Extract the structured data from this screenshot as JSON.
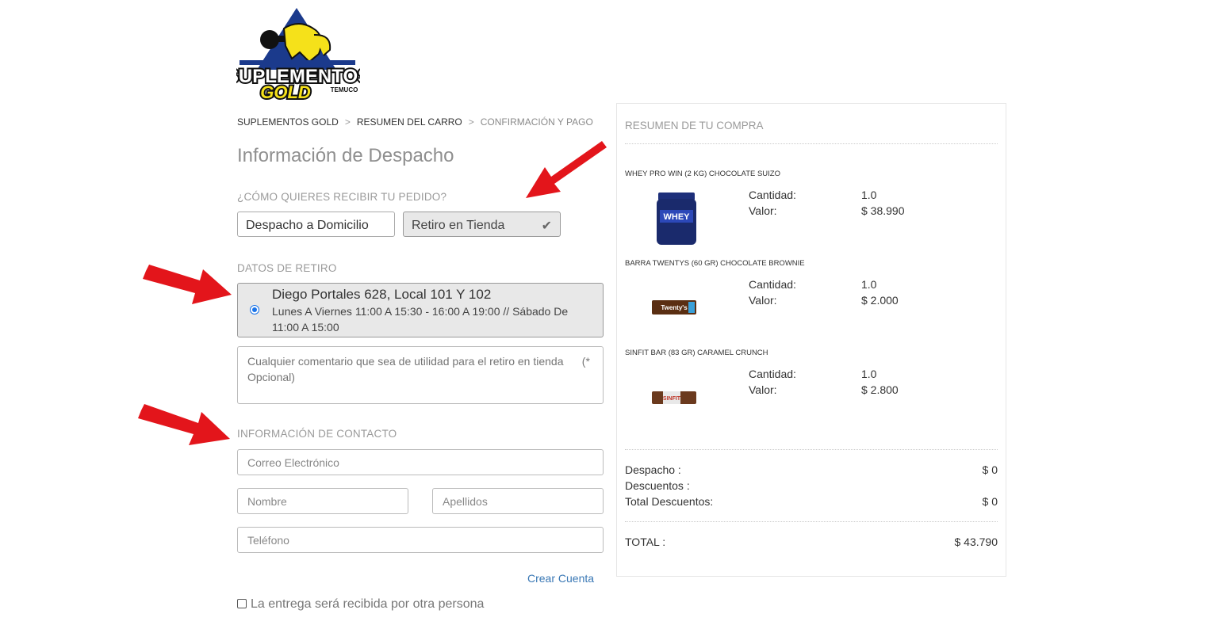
{
  "brand": {
    "logo_line1": "SUPLEMENTOS",
    "logo_line2": "GOLD",
    "logo_city": "TEMUCO"
  },
  "breadcrumb": [
    "SUPLEMENTOS GOLD",
    "RESUMEN DEL CARRO",
    "CONFIRMACIÓN Y PAGO"
  ],
  "breadcrumb_separator": ">",
  "page_title": "Información de Despacho",
  "delivery": {
    "question": "¿CÓMO QUIERES RECIBIR TU PEDIDO?",
    "options": [
      "Despacho a Domicilio",
      "Retiro en Tienda"
    ],
    "selected": "Retiro en Tienda"
  },
  "pickup": {
    "label": "DATOS DE RETIRO",
    "store_name": "Diego Portales 628, Local 101 Y 102",
    "store_hours": "Lunes A Viernes 11:00 A 15:30 - 16:00 A 19:00 // Sábado De 11:00 A 15:00",
    "comment_placeholder": "Cualquier comentario que sea de utilidad para el retiro en tienda      (* Opcional)"
  },
  "contact": {
    "label": "INFORMACIÓN DE CONTACTO",
    "email_placeholder": "Correo Electrónico",
    "first_name_placeholder": "Nombre",
    "last_name_placeholder": "Apellidos",
    "phone_placeholder": "Teléfono",
    "create_account": "Crear Cuenta",
    "other_person_label": "La entrega será recibida por otra persona"
  },
  "summary": {
    "title": "RESUMEN DE TU COMPRA",
    "qty_label": "Cantidad:",
    "value_label": "Valor:",
    "products": [
      {
        "name": "WHEY PRO WIN (2 KG) CHOCOLATE SUIZO",
        "qty": "1.0",
        "value": "$ 38.990",
        "image_text": "WHEY"
      },
      {
        "name": "BARRA TWENTYS (60 GR) CHOCOLATE BROWNIE",
        "qty": "1.0",
        "value": "$ 2.000",
        "image_text": "Twenty's"
      },
      {
        "name": "SINFIT BAR (83 GR) CARAMEL CRUNCH",
        "qty": "1.0",
        "value": "$ 2.800",
        "image_text": "SINFIT"
      }
    ],
    "shipping_label": "Despacho :",
    "shipping_value": "$ 0",
    "discounts_label": "Descuentos :",
    "total_discounts_label": "Total Descuentos:",
    "total_discounts_value": "$ 0",
    "total_label": "TOTAL :",
    "total_value": "$ 43.790"
  },
  "colors": {
    "arrow": "#e3151b",
    "link": "#3a78b5",
    "logo_yellow": "#f5e11a",
    "logo_blue": "#1b3a8c"
  }
}
